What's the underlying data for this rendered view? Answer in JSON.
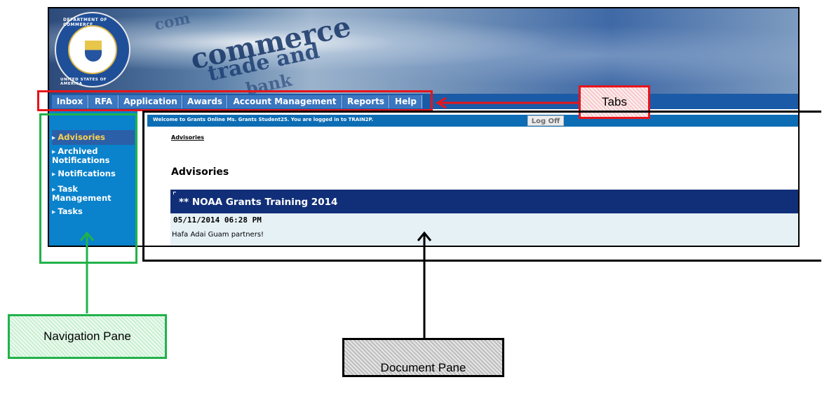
{
  "banner": {
    "words": [
      "com",
      "commerce",
      "trade and",
      "bank"
    ],
    "seal_text_top": "DEPARTMENT OF COMMERCE",
    "seal_text_bottom": "UNITED STATES OF AMERICA"
  },
  "tabs": [
    {
      "label": "Inbox"
    },
    {
      "label": "RFA"
    },
    {
      "label": "Application"
    },
    {
      "label": "Awards"
    },
    {
      "label": "Account Management"
    },
    {
      "label": "Reports"
    },
    {
      "label": "Help"
    }
  ],
  "nav": {
    "items": [
      {
        "label": "Advisories",
        "active": true
      },
      {
        "label_line1": "Archived",
        "label_line2": "Notifications"
      },
      {
        "label": "Notifications"
      },
      {
        "label_line1": "Task",
        "label_line2": "Management"
      },
      {
        "label": "Tasks"
      }
    ]
  },
  "header": {
    "welcome": "Welcome to Grants Online Ms. Grants Student25. You are logged in to TRAIN2P.",
    "logoff_label": "Log Off"
  },
  "main": {
    "breadcrumb": "Advisories",
    "title": "Advisories",
    "advisory": {
      "title": "** NOAA Grants Training 2014",
      "date": "05/11/2014 06:28 PM",
      "text": "Hafa Adai Guam partners!"
    }
  },
  "annotations": {
    "tabs_label": "Tabs",
    "nav_label": "Navigation Pane",
    "doc_label": "Document Pane"
  },
  "colors": {
    "tab_bar": "#1b5aa6",
    "nav_pane": "#0a82cc",
    "advisory_header": "#112f78",
    "annotation_red": "#e8141b",
    "annotation_green": "#21b24a"
  }
}
